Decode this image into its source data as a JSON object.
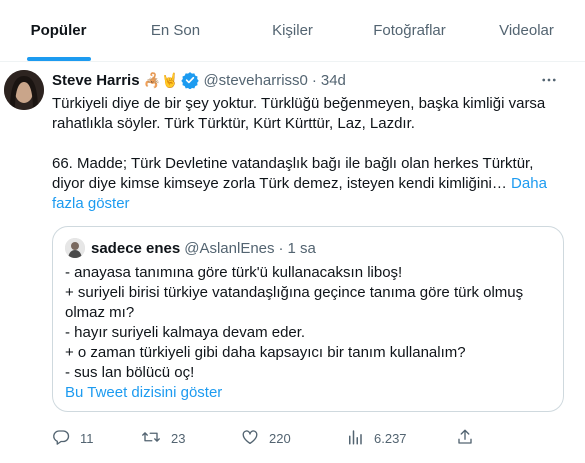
{
  "tabs": [
    {
      "label": "Popüler",
      "active": true
    },
    {
      "label": "En Son",
      "active": false
    },
    {
      "label": "Kişiler",
      "active": false
    },
    {
      "label": "Fotoğraflar",
      "active": false
    },
    {
      "label": "Videolar",
      "active": false
    }
  ],
  "tweet": {
    "author_name": "Steve Harris",
    "author_emoji": "🦂🤘",
    "handle": "@steveharriss0",
    "separator": "·",
    "time": "34d",
    "paragraph1": "Türkiyeli diye de bir şey yoktur. Türklüğü beğenmeyen, başka kimliği varsa rahatlıkla söyler. Türk Türktür, Kürt Kürttür, Laz, Lazdır.",
    "paragraph2": "66. Madde; Türk Devletine vatandaşlık bağı ile bağlı olan herkes Türktür, diyor diye kimse kimseye zorla Türk demez, isteyen kendi kimliğini… ",
    "show_more": "Daha fazla göster",
    "quote": {
      "author_name": "sadece enes",
      "handle": "@AslanlEnes",
      "separator": "·",
      "time": "1 sa",
      "lines": [
        "- anayasa tanımına göre türk'ü kullanacaksın liboş!",
        "+ suriyeli birisi türkiye vatandaşlığına geçince tanıma göre türk olmuş olmaz mı?",
        "- hayır suriyeli kalmaya devam eder.",
        "+ o zaman türkiyeli gibi daha kapsayıcı bir tanım kullanalım?",
        "- sus lan bölücü oç!"
      ],
      "thread_link": "Bu Tweet dizisini göster"
    },
    "actions": {
      "replies": "11",
      "retweets": "23",
      "likes": "220",
      "views": "6.237"
    }
  },
  "colors": {
    "accent": "#1d9bf0",
    "secondary_text": "#536471",
    "border": "#cfd9de"
  }
}
